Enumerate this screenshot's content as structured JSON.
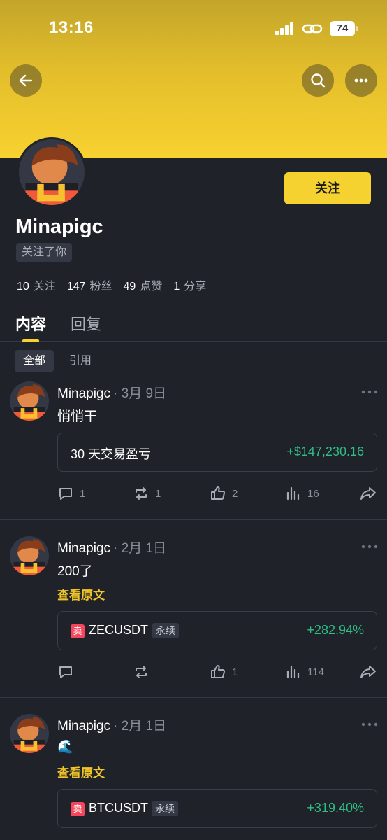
{
  "status": {
    "time": "13:16",
    "battery": "74"
  },
  "profile": {
    "name": "Minapigc",
    "follows_you": "关注了你",
    "follow_button": "关注",
    "stats": [
      {
        "num": "10",
        "label": "关注"
      },
      {
        "num": "147",
        "label": "粉丝"
      },
      {
        "num": "49",
        "label": "点赞"
      },
      {
        "num": "1",
        "label": "分享"
      }
    ]
  },
  "tabs": {
    "content": "内容",
    "reply": "回复"
  },
  "subtabs": {
    "all": "全部",
    "quote": "引用"
  },
  "posts": [
    {
      "author": "Minapigc",
      "date": "· 3月 9日",
      "text": "悄悄干",
      "card": {
        "label": "30 天交易盈亏",
        "value": "+$147,230.16"
      },
      "comments": "1",
      "reposts": "1",
      "likes": "2",
      "views": "16"
    },
    {
      "author": "Minapigc",
      "date": "· 2月 1日",
      "text": "200了",
      "view_original": "查看原文",
      "card": {
        "side": "卖",
        "pair": "ZECUSDT",
        "type": "永续",
        "value": "+282.94%"
      },
      "comments": "",
      "reposts": "",
      "likes": "1",
      "views": "114"
    },
    {
      "author": "Minapigc",
      "date": "· 2月 1日",
      "text": "🌊",
      "view_original": "查看原文",
      "card": {
        "side": "卖",
        "pair": "BTCUSDT",
        "type": "永续",
        "value": "+319.40%"
      }
    }
  ],
  "colors": {
    "accent": "#f6d230",
    "positive": "#2ebd85",
    "sell": "#f6465d",
    "background": "#1f2229"
  }
}
